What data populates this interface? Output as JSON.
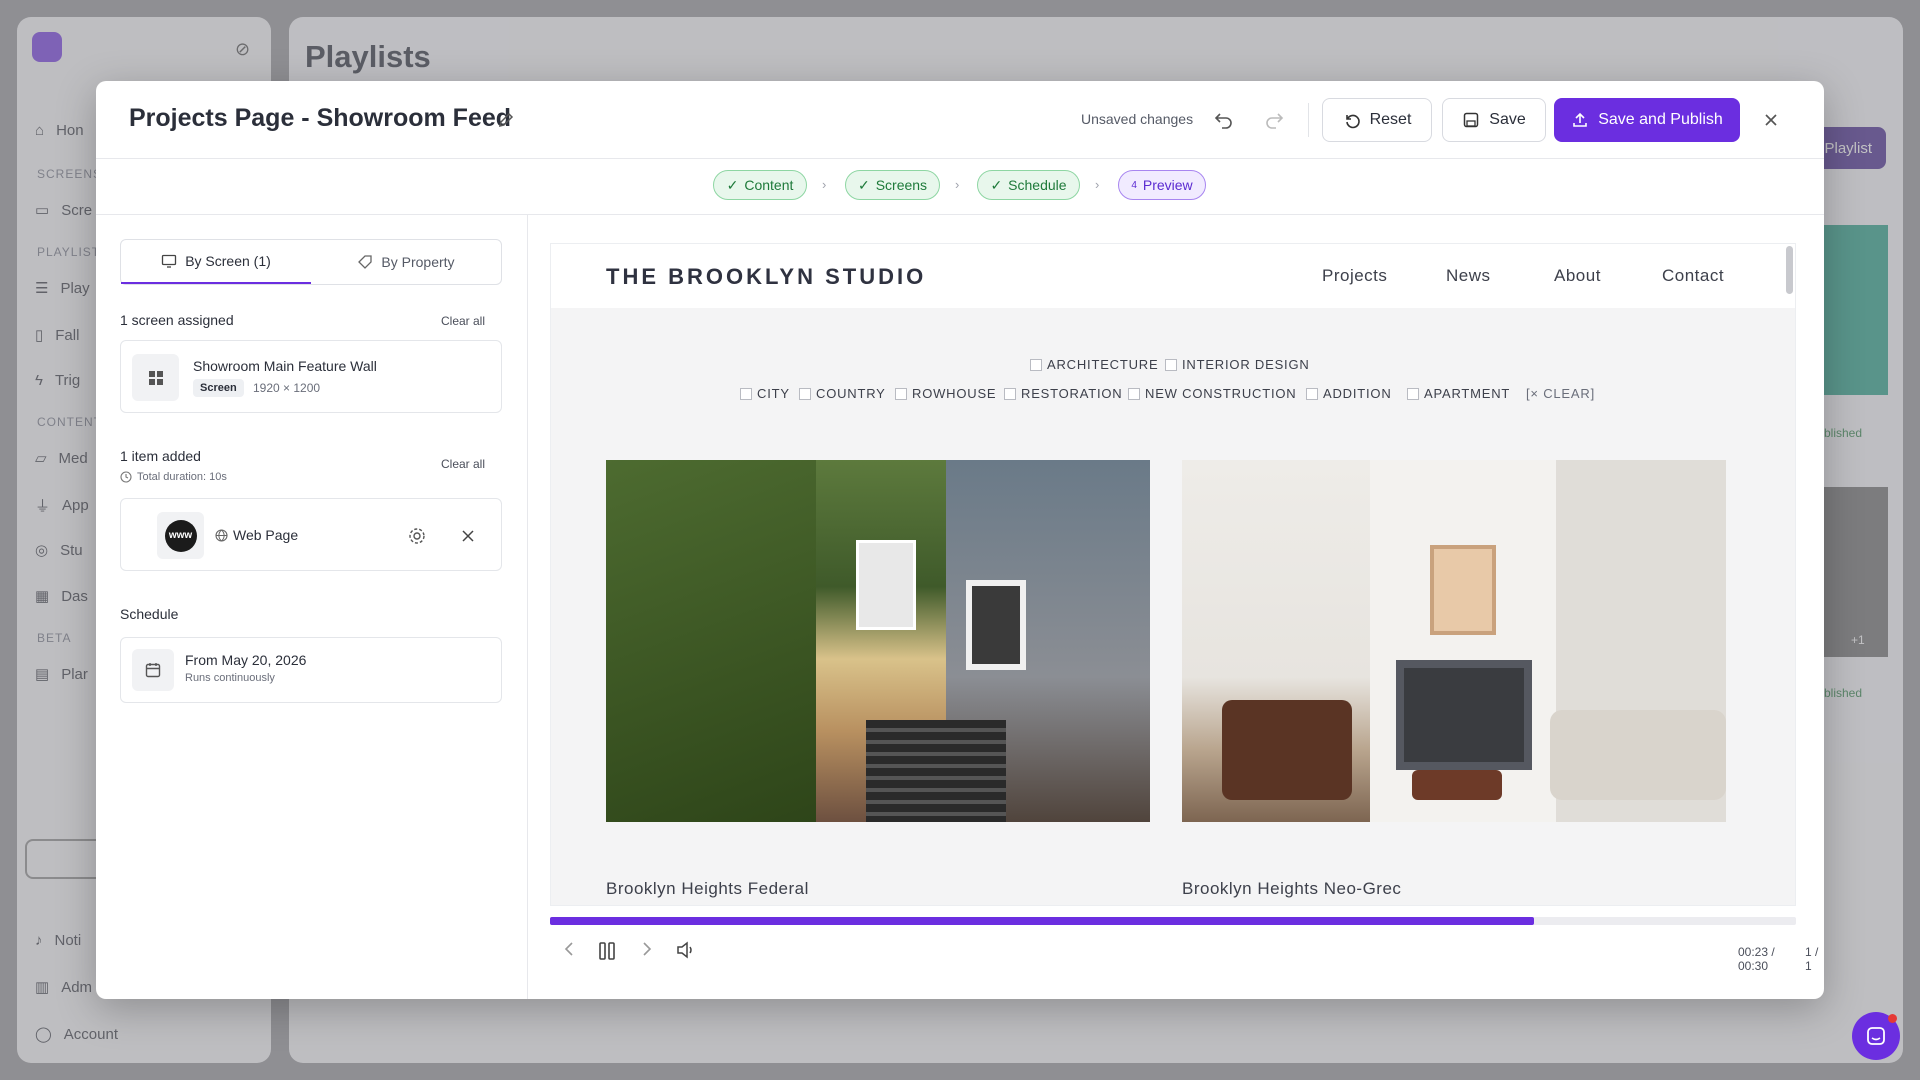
{
  "app": {
    "page_title": "Playlists",
    "sidebar_sections": [
      "SCREENS",
      "PLAYLIST",
      "CONTENT",
      "BETA"
    ],
    "sidebar_items": [
      "Hon",
      "Scre",
      "Play",
      "Fall",
      "Trig",
      "Med",
      "App",
      "Stu",
      "Das",
      "Plar",
      "Noti",
      "Adm",
      "Account"
    ],
    "bg_button": "Playlist",
    "bg_badges": [
      "blished",
      "blished"
    ],
    "bg_count": "+1"
  },
  "modal": {
    "title": "Projects Page - Showroom Feed",
    "unsaved_text": "Unsaved changes",
    "reset_label": "Reset",
    "save_label": "Save",
    "publish_label": "Save and Publish",
    "accent": "#6b2ee0"
  },
  "steps": [
    {
      "label": "Content",
      "marker": "✓"
    },
    {
      "label": "Screens",
      "marker": "✓"
    },
    {
      "label": "Schedule",
      "marker": "✓"
    },
    {
      "label": "Preview",
      "marker": "4"
    }
  ],
  "left": {
    "tabs": [
      "By Screen (1)",
      "By Property"
    ],
    "screens_count": "1 screen assigned",
    "clear_all": "Clear all",
    "screen": {
      "name": "Showroom Main Feature Wall",
      "tag": "Screen",
      "resolution": "1920 × 1200"
    },
    "items_count": "1 item added",
    "duration": "Total duration: 10s",
    "item": {
      "name": "Web Page",
      "thumb": "www"
    },
    "schedule_heading": "Schedule",
    "schedule": {
      "from": "From May 20, 2026",
      "note": "Runs continuously"
    }
  },
  "preview": {
    "brand": "THE BROOKLYN STUDIO",
    "nav": [
      "Projects",
      "News",
      "About",
      "Contact"
    ],
    "filters_row1": [
      "ARCHITECTURE",
      "INTERIOR DESIGN"
    ],
    "filters_row2": [
      "CITY",
      "COUNTRY",
      "ROWHOUSE",
      "RESTORATION",
      "NEW CONSTRUCTION",
      "ADDITION",
      "APARTMENT"
    ],
    "clear_filter": "[× CLEAR]",
    "projects": [
      "Brooklyn Heights Federal",
      "Brooklyn Heights Neo-Grec"
    ],
    "progress": 0.79,
    "time": "00:23 / 00:30",
    "page": "1 / 1"
  }
}
